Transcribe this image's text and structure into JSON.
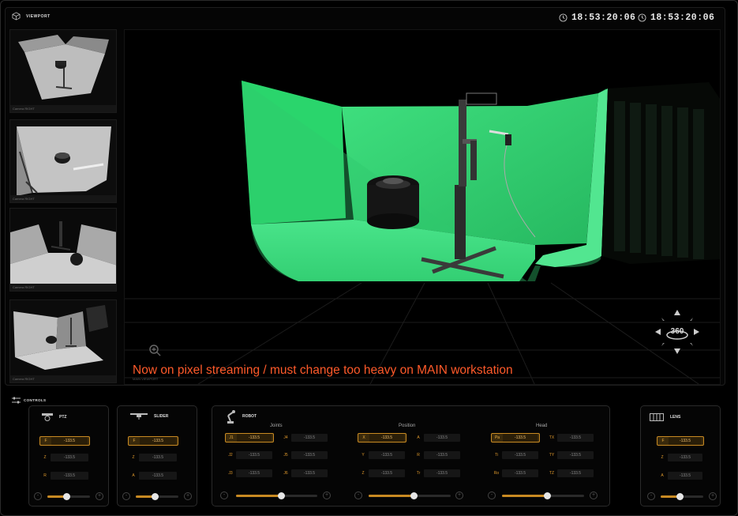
{
  "viewport": {
    "title": "VIEWPORT",
    "clock_1": "18:53:20:06",
    "clock_2": "18:53:20:06"
  },
  "thumbnails": [
    {
      "caption": "Camera RIGHT"
    },
    {
      "caption": "Camera RIGHT"
    },
    {
      "caption": "Camera RIGHT"
    },
    {
      "caption": "Camera RIGHT"
    }
  ],
  "main_view": {
    "label": "MAIN VIEWPORT",
    "stream_notice": "Now on pixel streaming / must change too heavy on MAIN workstation",
    "nav_label": "360"
  },
  "controls": {
    "title": "CONTROLS"
  },
  "ptz": {
    "title": "PTZ",
    "rows": [
      {
        "label": "F",
        "value": "-133.5"
      },
      {
        "label": "Z",
        "value": "-133.5"
      },
      {
        "label": "R",
        "value": "-133.5"
      }
    ],
    "slider": 0.45
  },
  "slider_panel": {
    "title": "SLIDER",
    "rows": [
      {
        "label": "F",
        "value": "-133.5"
      },
      {
        "label": "Z",
        "value": "-133.5"
      },
      {
        "label": "A",
        "value": "-133.5"
      }
    ],
    "slider": 0.45
  },
  "robot": {
    "title": "ROBOT",
    "joints": {
      "title": "Joints",
      "rows": [
        {
          "label": "J1",
          "value": "-133.5"
        },
        {
          "label": "J4",
          "value": "-133.5"
        },
        {
          "label": "J2",
          "value": "-133.5"
        },
        {
          "label": "J5",
          "value": "-133.5"
        },
        {
          "label": "J3",
          "value": "-133.5"
        },
        {
          "label": "J6",
          "value": "-133.5"
        }
      ],
      "slider": 0.55
    },
    "position": {
      "title": "Position",
      "rows": [
        {
          "label": "X",
          "value": "-133.5"
        },
        {
          "label": "A",
          "value": "-133.5"
        },
        {
          "label": "Y",
          "value": "-133.5"
        },
        {
          "label": "R",
          "value": "-133.5"
        },
        {
          "label": "Z",
          "value": "-133.5"
        },
        {
          "label": "Tr",
          "value": "-133.5"
        }
      ],
      "slider": 0.55
    },
    "head": {
      "title": "Head",
      "rows": [
        {
          "label": "Pa",
          "value": "-133.5"
        },
        {
          "label": "TX",
          "value": "-133.5"
        },
        {
          "label": "Ti",
          "value": "-133.5"
        },
        {
          "label": "TY",
          "value": "-133.5"
        },
        {
          "label": "Ro",
          "value": "-133.5"
        },
        {
          "label": "TZ",
          "value": "-133.5"
        }
      ],
      "slider": 0.55
    }
  },
  "lens": {
    "title": "LENS",
    "rows": [
      {
        "label": "F",
        "value": "-133.5"
      },
      {
        "label": "Z",
        "value": "-133.5"
      },
      {
        "label": "A",
        "value": "-133.5"
      }
    ],
    "slider": 0.45
  },
  "colors": {
    "accent": "#c88a22",
    "green_screen": "#3bd879",
    "notice": "#ff5a2a"
  }
}
